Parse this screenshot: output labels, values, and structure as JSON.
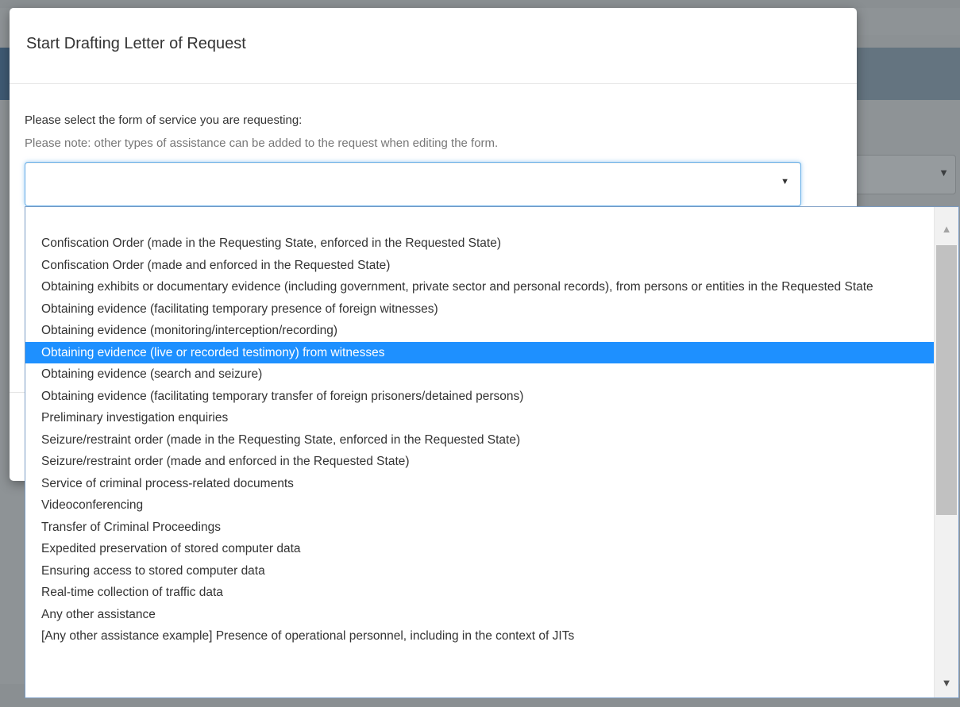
{
  "modal": {
    "title": "Start Drafting Letter of Request",
    "prompt": "Please select the form of service you are requesting:",
    "note": "Please note: other types of assistance can be added to the request when editing the form.",
    "select": {
      "value": "",
      "arrow_icon": "caret-down-icon"
    }
  },
  "dropdown": {
    "selected_index": 5,
    "options": [
      "Confiscation Order (made in the Requesting State, enforced in the Requested State)",
      "Confiscation Order (made and enforced in the Requested State)",
      "Obtaining exhibits or documentary evidence (including government, private sector and personal records), from persons or entities in the Requested State",
      "Obtaining evidence (facilitating temporary presence of foreign witnesses)",
      "Obtaining evidence (monitoring/interception/recording)",
      "Obtaining evidence (live or recorded testimony) from witnesses",
      "Obtaining evidence (search and seizure)",
      "Obtaining evidence (facilitating temporary transfer of foreign prisoners/detained persons)",
      "Preliminary investigation enquiries",
      "Seizure/restraint order (made in the Requesting State, enforced in the Requested State)",
      "Seizure/restraint order (made and enforced in the Requested State)",
      "Service of criminal process-related documents",
      "Videoconferencing",
      "Transfer of Criminal Proceedings",
      "Expedited preservation of stored computer data",
      "Ensuring access to stored computer data",
      "Real-time collection of traffic data",
      "Any other assistance",
      "[Any other assistance example] Presence of operational personnel, including in the context of JITs"
    ],
    "scroll_position_fraction": 0.0,
    "icons": {
      "scroll_up": "scroll-up-arrow-icon",
      "scroll_down": "scroll-down-arrow-icon"
    }
  },
  "colors": {
    "selected_bg": "#1e90ff",
    "selected_text": "#ffffff",
    "overlay": "#8e9396",
    "focus_border": "#66afe9"
  }
}
